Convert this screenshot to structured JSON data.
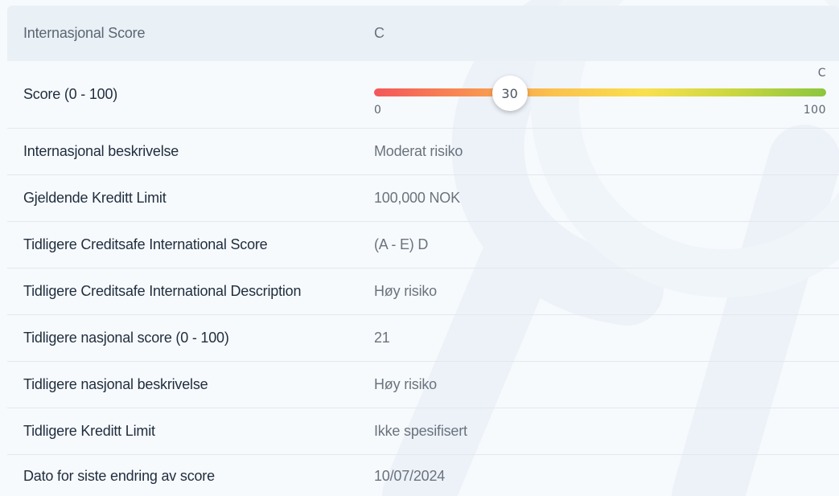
{
  "header": {
    "label": "Internasjonal Score",
    "value": "C"
  },
  "score": {
    "label": "Score (0 - 100)",
    "value": 30,
    "value_text": "30",
    "min_label": "0",
    "max_label": "100",
    "grade_label": "C",
    "gradient_colors": [
      "#f4565a",
      "#f88c53",
      "#fbc24e",
      "#f9e04e",
      "#c9d640",
      "#8cc63f"
    ]
  },
  "rows": [
    {
      "label": "Internasjonal beskrivelse",
      "value": "Moderat risiko"
    },
    {
      "label": "Gjeldende Kreditt Limit",
      "value": "100,000 NOK"
    },
    {
      "label": "Tidligere Creditsafe International Score",
      "value": "(A - E) D"
    },
    {
      "label": "Tidligere Creditsafe International Description",
      "value": "Høy risiko"
    },
    {
      "label": "Tidligere nasjonal score (0 - 100)",
      "value": "21"
    },
    {
      "label": "Tidligere nasjonal beskrivelse",
      "value": "Høy risiko"
    },
    {
      "label": "Tidligere Kreditt Limit",
      "value": "Ikke spesifisert"
    },
    {
      "label": "Dato for siste endring av score",
      "value": "10/07/2024"
    }
  ],
  "colors": {
    "header_bg": "#e9f0f6",
    "panel_bg": "#f7fafd",
    "label_text": "#1f2d3d",
    "value_text": "#6a737d",
    "divider": "#e3e8ee"
  }
}
